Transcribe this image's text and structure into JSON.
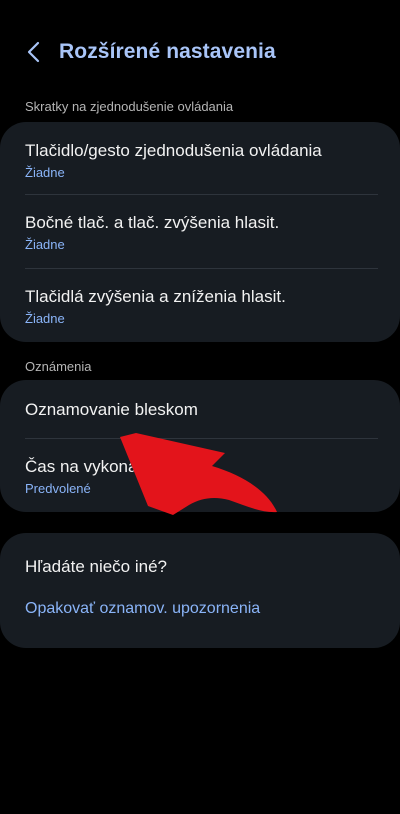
{
  "header": {
    "title": "Rozšírené nastavenia",
    "back_icon": "chevron-left-icon",
    "accent_color": "#a9c5f8"
  },
  "sections": [
    {
      "label": "Skratky na zjednodušenie ovládania",
      "items": [
        {
          "title": "Tlačidlo/gesto zjednodušenia ovládania",
          "value": "Žiadne"
        },
        {
          "title": "Bočné tlač. a tlač. zvýšenia hlasit.",
          "value": "Žiadne"
        },
        {
          "title": "Tlačidlá zvýšenia a zníženia hlasit.",
          "value": "Žiadne"
        }
      ]
    },
    {
      "label": "Oznámenia",
      "items": [
        {
          "title": "Oznamovanie bleskom"
        },
        {
          "title": "Čas na vykonanie akcie",
          "value": "Predvolené"
        }
      ]
    }
  ],
  "suggest": {
    "title": "Hľadáte niečo iné?",
    "link": "Opakovať oznamov. upozornenia"
  },
  "colors": {
    "background": "#000000",
    "card": "#171c22",
    "value_text": "#8ab4f8",
    "annotation_arrow": "#e3141b"
  }
}
